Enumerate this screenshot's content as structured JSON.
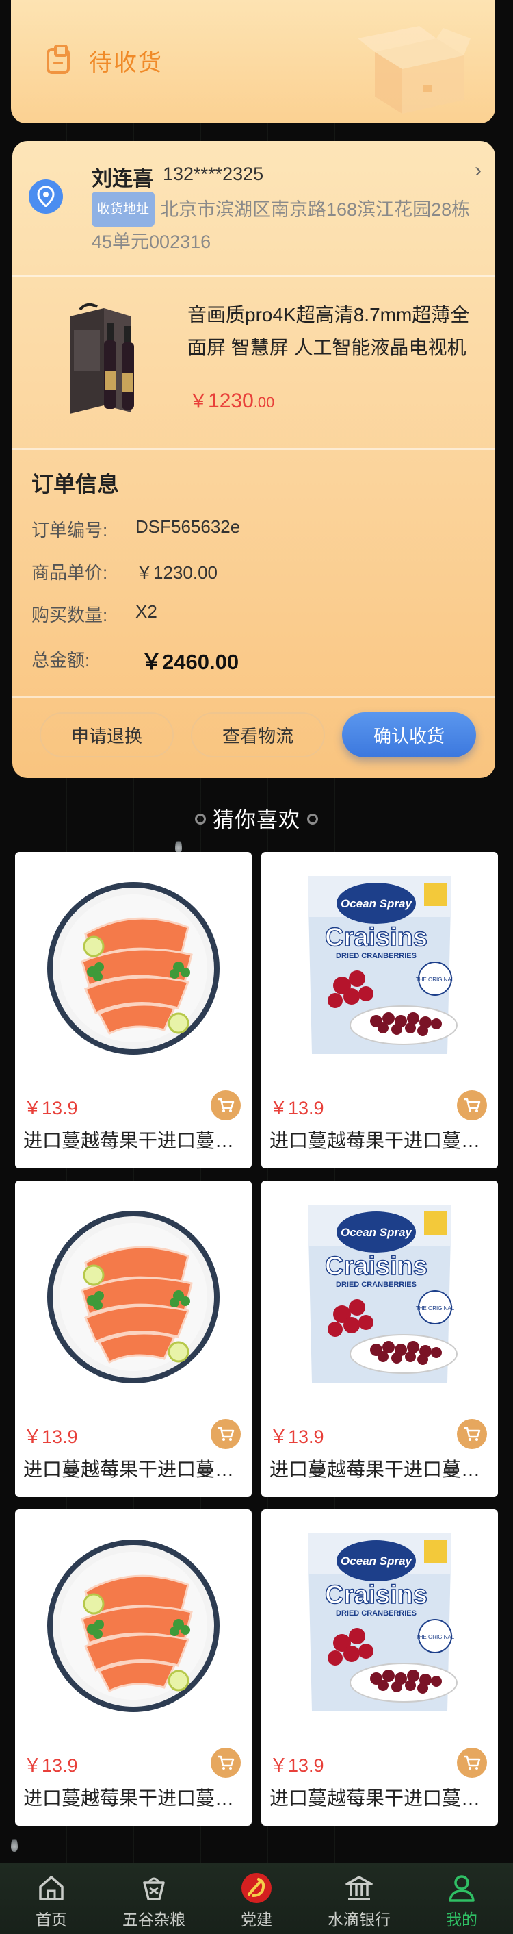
{
  "status": {
    "label": "待收货"
  },
  "address": {
    "name": "刘连喜",
    "phone": "132****2325",
    "tag": "收货地址",
    "text": "北京市滨湖区南京路168滨江花园28栋45单元002316"
  },
  "product": {
    "title": "音画质pro4K超高清8.7mm超薄全面屏 智慧屏 人工智能液晶电视机",
    "price_currency": "￥",
    "price_int": "1230",
    "price_dec": ".00"
  },
  "order_info": {
    "title": "订单信息",
    "rows": [
      {
        "label": "订单编号:",
        "value": "DSF565632e"
      },
      {
        "label": "商品单价:",
        "value": "￥1230.00"
      },
      {
        "label": "购买数量:",
        "value": "X2"
      },
      {
        "label": "总金额:",
        "value": "￥2460.00"
      }
    ]
  },
  "actions": {
    "refund": "申请退换",
    "logistics": "查看物流",
    "confirm": "确认收货"
  },
  "recommend": {
    "title": "猜你喜欢",
    "items": [
      {
        "price": "￥13.9",
        "name": "进口蔓越莓果干进口蔓越莓果干",
        "image": "salmon"
      },
      {
        "price": "￥13.9",
        "name": "进口蔓越莓果干进口蔓越莓果干",
        "image": "craisins"
      },
      {
        "price": "￥13.9",
        "name": "进口蔓越莓果干进口蔓越莓果干",
        "image": "salmon"
      },
      {
        "price": "￥13.9",
        "name": "进口蔓越莓果干进口蔓越莓果干",
        "image": "craisins"
      },
      {
        "price": "￥13.9",
        "name": "进口蔓越莓果干进口蔓越莓果干",
        "image": "salmon"
      },
      {
        "price": "￥13.9",
        "name": "进口蔓越莓果干进口蔓越莓果干",
        "image": "craisins"
      }
    ],
    "craisins_brand": "Ocean Spray",
    "craisins_label": "Craisins",
    "craisins_sub": "DRIED CRANBERRIES",
    "craisins_badge": "THE ORIGINAL"
  },
  "tabbar": {
    "items": [
      {
        "label": "首页",
        "icon": "home-icon"
      },
      {
        "label": "五谷杂粮",
        "icon": "grain-icon"
      },
      {
        "label": "党建",
        "icon": "party-emblem-icon"
      },
      {
        "label": "水滴银行",
        "icon": "bank-icon"
      },
      {
        "label": "我的",
        "icon": "user-icon"
      }
    ],
    "active_index": 4
  },
  "colors": {
    "accent_orange": "#f08a28",
    "price_red": "#e8403a",
    "primary_blue": "#3c78de",
    "active_green": "#2fbf64"
  }
}
